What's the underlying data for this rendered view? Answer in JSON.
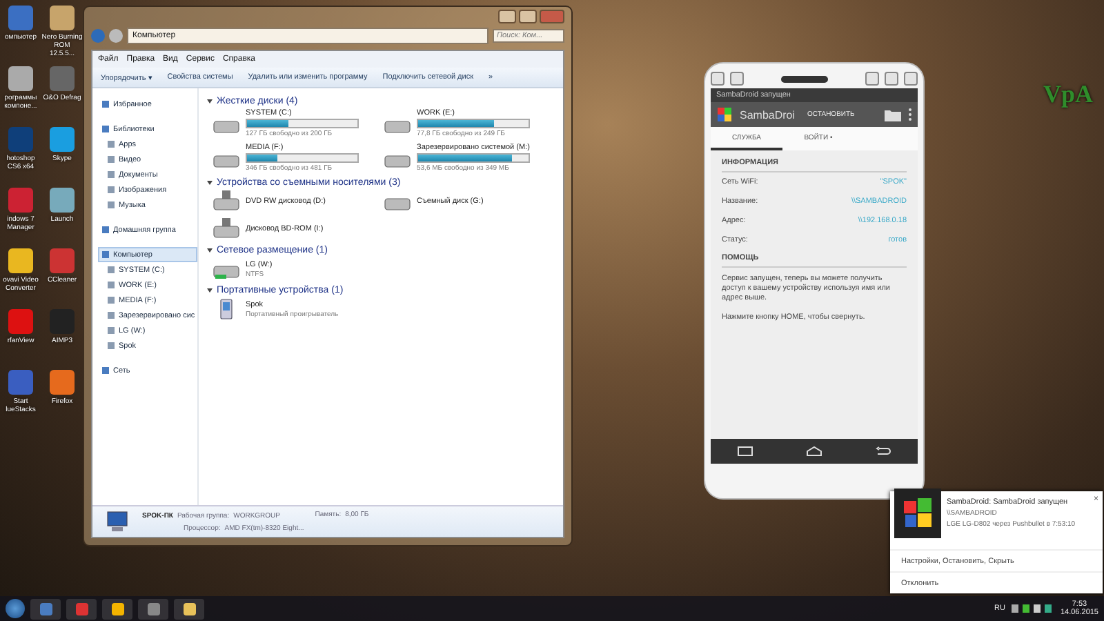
{
  "desktop_icons": [
    {
      "label": "омпьютер"
    },
    {
      "label": "Nero Burning ROM 12.5.5..."
    },
    {
      "label": "рограммы компоне..."
    },
    {
      "label": "O&O Defrag"
    },
    {
      "label": "hotoshop CS6 x64"
    },
    {
      "label": "Skype"
    },
    {
      "label": "indows 7 Manager"
    },
    {
      "label": "Launch"
    },
    {
      "label": "ovavi Video Converter"
    },
    {
      "label": "CCleaner"
    },
    {
      "label": "rfanView"
    },
    {
      "label": "AIMP3"
    },
    {
      "label": "Start lueStacks"
    },
    {
      "label": "Firefox"
    }
  ],
  "explorer": {
    "breadcrumb": "Компьютер",
    "search": {
      "placeholder": "Поиск: Ком..."
    },
    "menu": [
      "Файл",
      "Правка",
      "Вид",
      "Сервис",
      "Справка"
    ],
    "toolbar": [
      "Упорядочить ▾",
      "Свойства системы",
      "Удалить или изменить программу",
      "Подключить сетевой диск",
      "»"
    ],
    "nav": [
      {
        "label": "Избранное",
        "selected": false
      },
      {
        "label": "Библиотеки",
        "selected": false,
        "children": [
          {
            "label": "Apps",
            "selected": false
          },
          {
            "label": "Видео",
            "selected": false
          },
          {
            "label": "Документы",
            "selected": false
          },
          {
            "label": "Изображения",
            "selected": false
          },
          {
            "label": "Музыка",
            "selected": false
          }
        ]
      },
      {
        "label": "Домашняя группа",
        "selected": false
      },
      {
        "label": "Компьютер",
        "selected": true,
        "children": [
          {
            "label": "SYSTEM (C:)",
            "selected": false
          },
          {
            "label": "WORK (E:)",
            "selected": false
          },
          {
            "label": "MEDIA (F:)",
            "selected": false
          },
          {
            "label": "Зарезервировано сис",
            "selected": false
          },
          {
            "label": "LG (W:)",
            "selected": false
          },
          {
            "label": "Spok",
            "selected": false
          }
        ]
      },
      {
        "label": "Сеть",
        "selected": false
      }
    ],
    "groups": [
      {
        "title": "Жесткие диски (4)",
        "items": [
          {
            "kind": "disk",
            "name": "SYSTEM (C:)",
            "level": 0.37,
            "info": "127 ГБ свободно из 200 ГБ"
          },
          {
            "kind": "disk",
            "name": "WORK (E:)",
            "level": 0.69,
            "info": "77,8 ГБ свободно из 249 ГБ"
          },
          {
            "kind": "disk",
            "name": "MEDIA (F:)",
            "level": 0.28,
            "info": "346 ГБ свободно из 481 ГБ"
          },
          {
            "kind": "disk",
            "name": "Зарезервировано системой (M:)",
            "level": 0.85,
            "info": "53,6 МБ свободно из 349 МБ"
          }
        ]
      },
      {
        "title": "Устройства со съемными носителями (3)",
        "items": [
          {
            "kind": "optical",
            "name": "DVD RW дисковод (D:)"
          },
          {
            "kind": "removable",
            "name": "Съемный диск (G:)"
          },
          {
            "kind": "optical",
            "name": "Дисковод BD-ROM (I:)"
          }
        ]
      },
      {
        "title": "Сетевое размещение (1)",
        "items": [
          {
            "kind": "network",
            "name": "LG (W:)",
            "info": "NTFS"
          }
        ]
      },
      {
        "title": "Портативные устройства (1)",
        "items": [
          {
            "kind": "portable",
            "name": "Spok",
            "info": "Портативный проигрыватель"
          }
        ]
      }
    ],
    "details": {
      "computer": "SPOK-ПК",
      "workgroup_label": "Рабочая группа:",
      "workgroup": "WORKGROUP",
      "memory_label": "Память:",
      "memory": "8,00 ГБ",
      "cpu_label": "Процессор:",
      "cpu": "AMD FX(tm)-8320 Eight..."
    }
  },
  "phone": {
    "status": "SambaDroid запущен",
    "app_title": "SambaDroi",
    "stop_button": "ОСТАНОВИТЬ",
    "tabs": [
      {
        "label": "СЛУЖБА",
        "selected": true
      },
      {
        "label": "ВОЙТИ •",
        "selected": false
      }
    ],
    "info_header": "ИНФОРМАЦИЯ",
    "rows": [
      {
        "label": "Сеть WiFi:",
        "value": "\"SPOK\""
      },
      {
        "label": "Название:",
        "value": "\\\\SAMBADROID"
      },
      {
        "label": "Адрес:",
        "value": "\\\\192.168.0.18"
      },
      {
        "label": "Статус:",
        "value": "готов"
      }
    ],
    "help_header": "ПОМОЩЬ",
    "help": [
      "Сервис запущен, теперь вы можете получить доступ к вашему устройству используя имя или адрес выше.",
      "Нажмите кнопку HOME, чтобы свернуть."
    ]
  },
  "notification": {
    "title": "SambaDroid: SambaDroid запущен",
    "body": "\\\\SAMBADROID",
    "source": "LGE LG-D802 через Pushbullet в 7:53:10",
    "actions": "Настройки, Остановить, Скрыть",
    "dismiss": "Отклонить",
    "close": "×"
  },
  "taskbar": {
    "language": "RU",
    "time": "7:53",
    "date": "14.06.2015"
  },
  "logo": "VpA"
}
